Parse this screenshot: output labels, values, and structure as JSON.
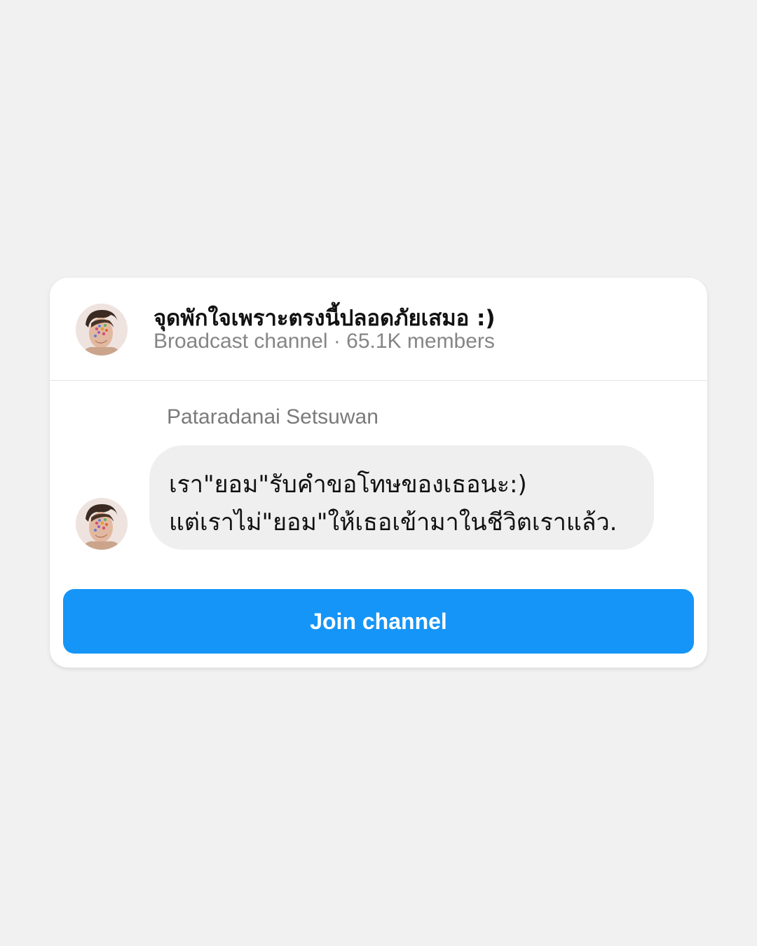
{
  "channel": {
    "title": "จุดพักใจเพราะตรงนี้ปลอดภัยเสมอ :)",
    "meta": "Broadcast channel · 65.1K members"
  },
  "message": {
    "sender": "Pataradanai Setsuwan",
    "lines": [
      "เรา\"ยอม\"รับคำขอโทษของเธอนะ:)",
      "แต่เราไม่\"ยอม\"ให้เธอเข้ามาในชีวิตเราแล้ว."
    ]
  },
  "actions": {
    "join_label": "Join channel"
  },
  "colors": {
    "page_background": "#f1f1f1",
    "card_background": "#ffffff",
    "bubble_background": "#efefef",
    "accent": "#1595f7"
  },
  "icons": {
    "channel_avatar": "profile-photo",
    "sender_avatar": "profile-photo"
  }
}
